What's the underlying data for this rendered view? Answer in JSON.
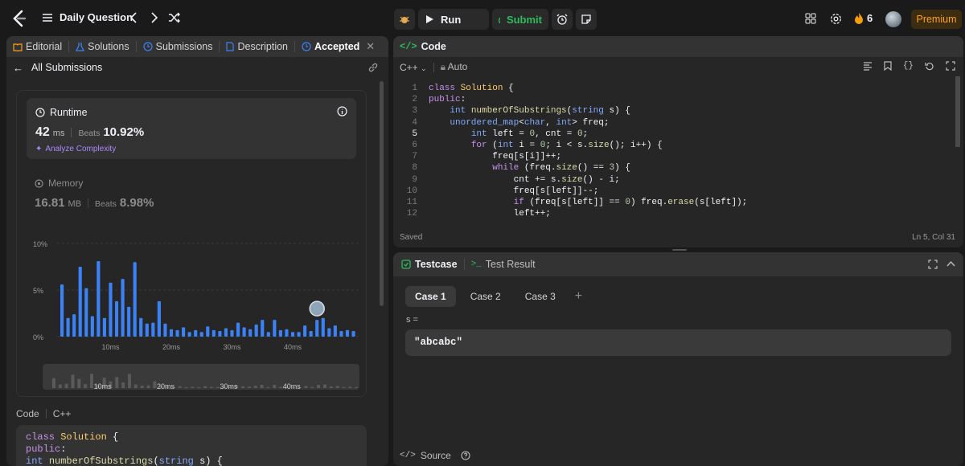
{
  "header": {
    "title": "Daily Question",
    "run_label": "Run",
    "submit_label": "Submit",
    "streak": "6",
    "premium_label": "Premium"
  },
  "left_tabs": [
    {
      "label": "Editorial"
    },
    {
      "label": "Solutions"
    },
    {
      "label": "Submissions"
    },
    {
      "label": "Description"
    },
    {
      "label": "Accepted"
    }
  ],
  "subheader": {
    "back_label": "All Submissions"
  },
  "runtime": {
    "title": "Runtime",
    "value": "42",
    "unit": "ms",
    "beats_label": "Beats",
    "beats_value": "10.92%",
    "analyze_label": "Analyze Complexity"
  },
  "memory": {
    "title": "Memory",
    "value": "16.81",
    "unit": "MB",
    "beats_label": "Beats",
    "beats_value": "8.98%"
  },
  "chart_data": {
    "type": "bar",
    "ylim": [
      0,
      10
    ],
    "yticks": [
      "10%",
      "5%",
      "0%"
    ],
    "xticks": [
      "10ms",
      "20ms",
      "30ms",
      "40ms"
    ],
    "values": [
      5.6,
      2.0,
      2.4,
      7.5,
      5.2,
      2.2,
      8.1,
      2.0,
      5.8,
      3.8,
      6.2,
      3.2,
      8.0,
      2.0,
      1.4,
      1.5,
      3.8,
      1.4,
      0.8,
      0.7,
      1.0,
      0.5,
      0.7,
      0.5,
      1.1,
      0.7,
      0.6,
      0.9,
      0.7,
      1.5,
      1.0,
      0.8,
      1.3,
      1.8,
      0.5,
      1.8,
      0.7,
      0.8,
      0.5,
      0.5,
      1.2,
      0.6,
      1.8,
      2.0,
      0.9,
      1.2,
      0.6,
      0.7,
      0.6
    ],
    "highlight_index": 42,
    "color": "#3b82f6",
    "grid": true
  },
  "mini_chart": {
    "xticks": [
      "10ms",
      "20ms",
      "30ms",
      "40ms"
    ]
  },
  "left_code": {
    "label": "Code",
    "lang": "C++",
    "lines": [
      "class Solution {",
      "public:",
      "    int numberOfSubstrings(string s) {"
    ]
  },
  "editor": {
    "title": "Code",
    "lang": "C++",
    "mode": "Auto",
    "status": "Saved",
    "position": "Ln 5, Col 31",
    "lines": [
      {
        "n": "1",
        "t": "class Solution {"
      },
      {
        "n": "2",
        "t": "public:"
      },
      {
        "n": "3",
        "t": "    int numberOfSubstrings(string s) {"
      },
      {
        "n": "4",
        "t": "    unordered_map<char, int> freq;"
      },
      {
        "n": "5",
        "t": "        int left = 0, cnt = 0;"
      },
      {
        "n": "6",
        "t": "        for (int i = 0; i < s.size(); i++) {"
      },
      {
        "n": "7",
        "t": "            freq[s[i]]++;"
      },
      {
        "n": "8",
        "t": "            while (freq.size() == 3) {"
      },
      {
        "n": "9",
        "t": "                cnt += s.size() - i;"
      },
      {
        "n": "10",
        "t": "                freq[s[left]]--;"
      },
      {
        "n": "11",
        "t": "                if (freq[s[left]] == 0) freq.erase(s[left]);"
      },
      {
        "n": "12",
        "t": "                left++;"
      }
    ]
  },
  "testcase": {
    "tab_label": "Testcase",
    "result_label": "Test Result",
    "cases": [
      "Case 1",
      "Case 2",
      "Case 3"
    ],
    "add": "+",
    "var_label": "s =",
    "value": "\"abcabc\"",
    "source_label": "Source"
  }
}
